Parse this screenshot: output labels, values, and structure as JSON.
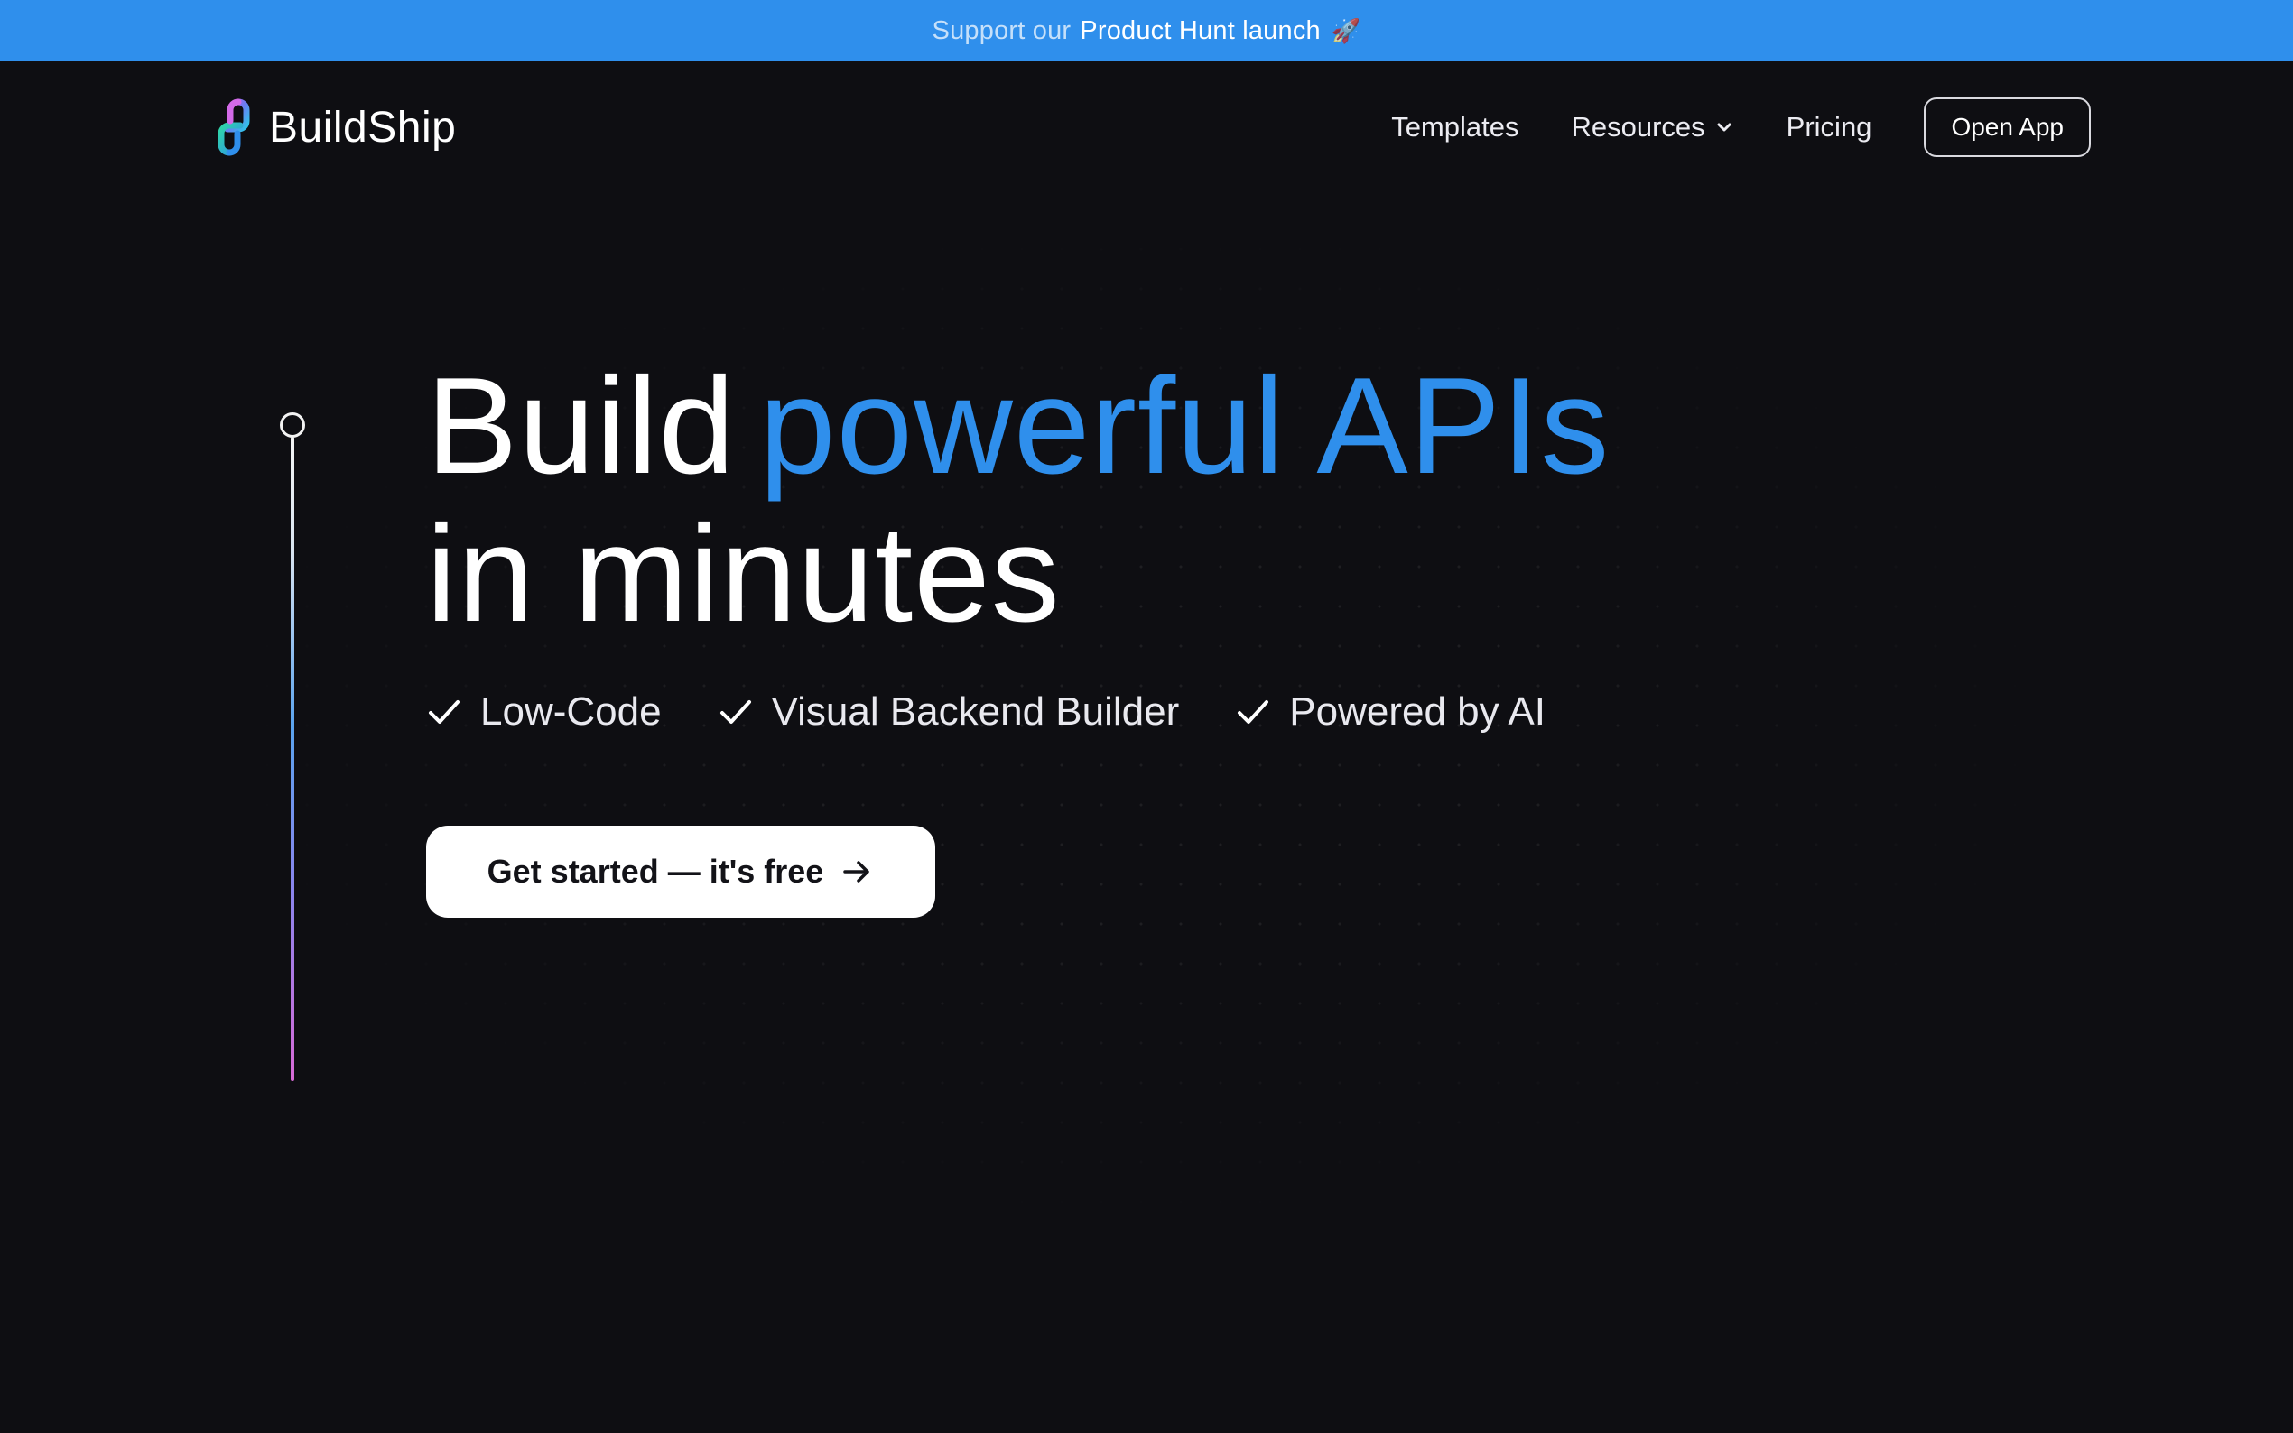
{
  "announcement": {
    "prefix": "Support our",
    "link": "Product Hunt launch",
    "icon": "rocket-icon"
  },
  "header": {
    "logo_text": "BuildShip",
    "nav": [
      {
        "label": "Templates"
      },
      {
        "label": "Resources",
        "icon": "chevron-down-icon"
      },
      {
        "label": "Pricing"
      }
    ],
    "open_app_label": "Open App"
  },
  "hero": {
    "title_part1": "Build",
    "title_highlight": "powerful APIs",
    "title_part2": "in minutes",
    "features": [
      {
        "label": "Low-Code",
        "icon": "check-icon"
      },
      {
        "label": "Visual Backend Builder",
        "icon": "check-icon"
      },
      {
        "label": "Powered by AI",
        "icon": "check-icon"
      }
    ],
    "cta_label": "Get started — it's free",
    "cta_icon": "arrow-right-icon"
  },
  "colors": {
    "accent": "#2f8fec",
    "background": "#0e0e12",
    "announce_bg": "#2f8fec"
  }
}
